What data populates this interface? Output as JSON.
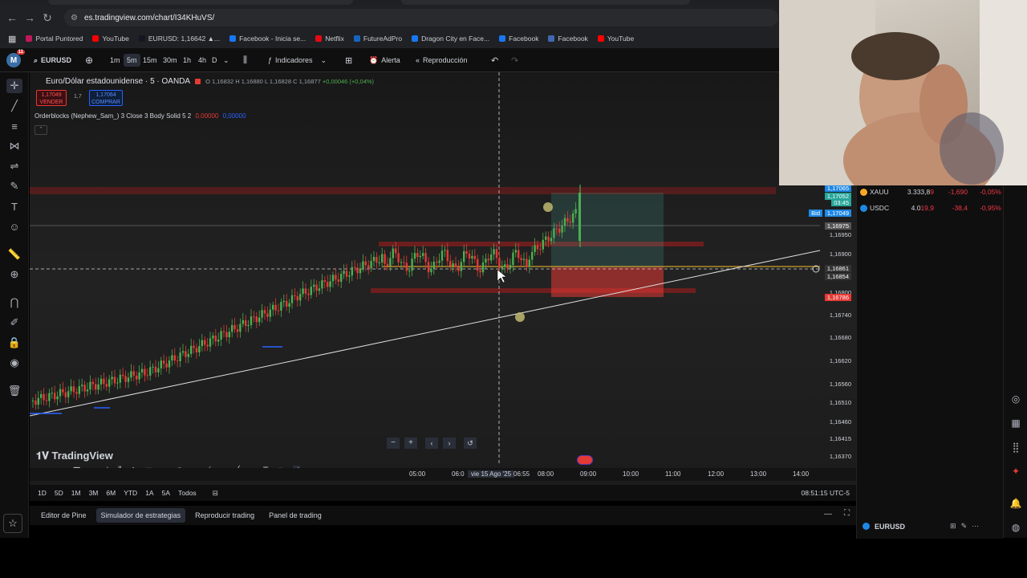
{
  "browser": {
    "url": "es.tradingview.com/chart/I34KHuVS/",
    "bookmarks": [
      {
        "label": "Portal Puntored",
        "color": "#c2185b"
      },
      {
        "label": "YouTube",
        "color": "#ff0000"
      },
      {
        "label": "EURUSD: 1,16642 ▲...",
        "color": "#131722"
      },
      {
        "label": "Facebook - Inicia se...",
        "color": "#1877f2"
      },
      {
        "label": "Netflix",
        "color": "#e50914"
      },
      {
        "label": "FutureAdPro",
        "color": "#1565c0"
      },
      {
        "label": "Dragon City en Face...",
        "color": "#1877f2"
      },
      {
        "label": "Facebook",
        "color": "#1877f2"
      },
      {
        "label": "Facebook",
        "color": "#4267b2"
      },
      {
        "label": "YouTube",
        "color": "#ff0000"
      }
    ]
  },
  "toolbar": {
    "avatar_letter": "M",
    "avatar_badge": "11",
    "symbol": "EURUSD",
    "intervals": [
      "1m",
      "5m",
      "15m",
      "30m",
      "1h",
      "4h",
      "D"
    ],
    "selected_interval": "5m",
    "indicators": "Indicadores",
    "alert": "Alerta",
    "replay": "Reproducción"
  },
  "legend": {
    "title": "Euro/Dólar estadounidense · 5 · OANDA",
    "ohlc": {
      "o": "O 1,16832",
      "h": "H 1,16880",
      "l": "L 1,16828",
      "c": "C 1,16877",
      "chg": "+0,00046 (+0,04%)"
    },
    "sell_price": "1,17049",
    "sell_label": "VENDER",
    "spread": "1,7",
    "buy_price": "1,17064",
    "buy_label": "COMPRAR",
    "indicator": "Orderblocks (Nephew_Sam_) 3 Close 3 Body Solid 5 2",
    "indicator_v1": "0,00000",
    "indicator_v2": "0,00000"
  },
  "price_axis": {
    "labels": [
      "1,16950",
      "1,16900",
      "1,16800",
      "1,16740",
      "1,16680",
      "1,16620",
      "1,16560",
      "1,16510",
      "1,16460",
      "1,16415",
      "1,16370"
    ],
    "tags": [
      {
        "text": "1,17065",
        "color": "#1e88e5"
      },
      {
        "text": "1,17052",
        "color": "#26a69a"
      },
      {
        "text": "03:45",
        "color": "#26a69a"
      },
      {
        "text": "1,17049",
        "color": "#1e88e5"
      },
      {
        "text": "1,16975",
        "color": "#555555"
      },
      {
        "text": "1,16861",
        "color": "#333333"
      },
      {
        "text": "1,16854",
        "color": "#333333"
      },
      {
        "text": "1,16786",
        "color": "#e53935"
      }
    ],
    "bid_label": "Bid"
  },
  "time_axis": {
    "labels": [
      "05:00",
      "06:0",
      "vie 15 Ago '25",
      "06:55",
      "08:00",
      "09:00",
      "10:00",
      "11:00",
      "12:00",
      "13:00",
      "14:00"
    ]
  },
  "ranges": [
    "1D",
    "5D",
    "1M",
    "3M",
    "6M",
    "YTD",
    "1A",
    "5A",
    "Todos"
  ],
  "clock": "08:51:15 UTC-5",
  "bottom_tabs": [
    "Editor de Pine",
    "Simulador de estrategias",
    "Reproducir trading",
    "Panel de trading"
  ],
  "active_bottom_tab": "Simulador de estrategias",
  "watchlist": [
    {
      "symbol": "XAUU",
      "last": "3.333,8",
      "last_tail": "9",
      "chg": "-1,690",
      "pct": "-0,05%",
      "icon_color": "#f9a825"
    },
    {
      "symbol": "USDC",
      "last": "4.0",
      "last_tail": "19,9",
      "chg": "-38,4",
      "pct": "-0,95%",
      "icon_color": "#1e88e5"
    }
  ],
  "watch_footer": "EURUSD",
  "logo": "TradingView"
}
